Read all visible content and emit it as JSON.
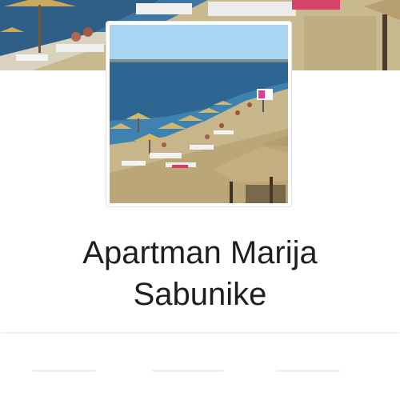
{
  "page": {
    "title_line1": "Apartman Marija",
    "title_line2": "Sabunike"
  },
  "images": {
    "cover": "beach-cover-photo",
    "profile": "beach-profile-photo"
  },
  "colors": {
    "sea": "#2b5f8f",
    "sky": "#9fd1ef",
    "sand": "#c9b98f",
    "title_text": "#1c1e21"
  }
}
